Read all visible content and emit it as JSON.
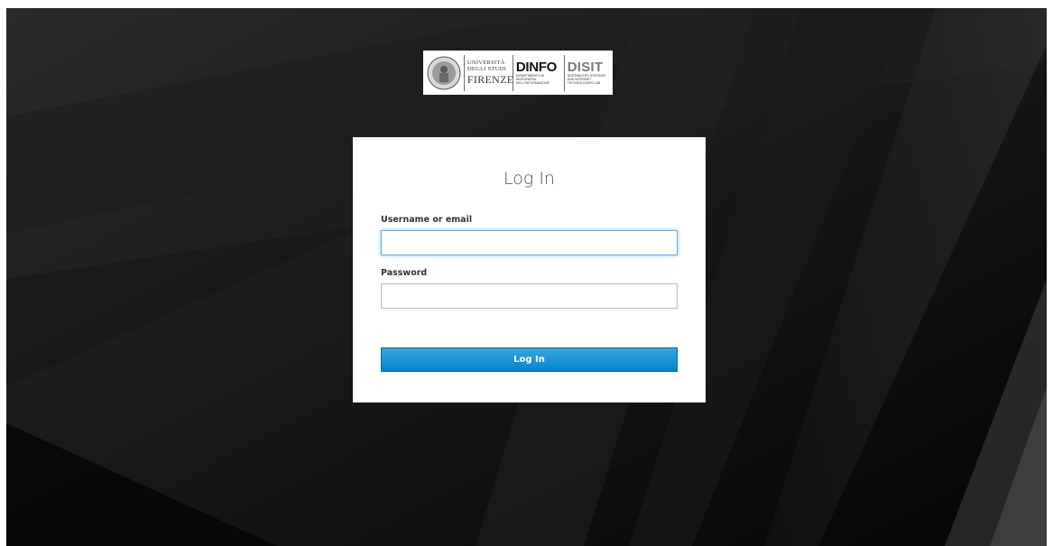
{
  "logo": {
    "university_line1": "UNIVERSITÀ",
    "university_line2": "DEGLI STUDI",
    "university_line3": "FIRENZE",
    "dinfo_title": "DINFO",
    "dinfo_line1": "DIPARTIMENTO DI",
    "dinfo_line2": "INGEGNERIA",
    "dinfo_line3": "DELL'INFORMAZIONE",
    "disit_title": "DISIT",
    "disit_line1": "DISTRIBUTED SYSTEMS",
    "disit_line2": "AND INTERNET",
    "disit_line3": "TECHNOLOGIES LAB"
  },
  "login": {
    "title": "Log In",
    "username_label": "Username or email",
    "username_value": "",
    "password_label": "Password",
    "password_value": "",
    "submit_label": "Log In"
  },
  "colors": {
    "background": "#0b0b0b",
    "button": "#0085cf",
    "focus_border": "#66afe9"
  }
}
